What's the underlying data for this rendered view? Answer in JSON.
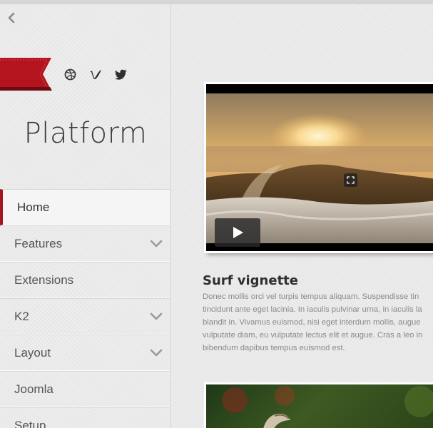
{
  "sidebar": {
    "back_icon": "chevron-left-icon",
    "social": [
      {
        "name": "dribbble-icon"
      },
      {
        "name": "vimeo-icon"
      },
      {
        "name": "twitter-icon"
      }
    ],
    "brand": "Platform",
    "accent_color": "#a31720",
    "nav": [
      {
        "label": "Home",
        "active": true,
        "has_submenu": false
      },
      {
        "label": "Features",
        "active": false,
        "has_submenu": true
      },
      {
        "label": "Extensions",
        "active": false,
        "has_submenu": false
      },
      {
        "label": "K2",
        "active": false,
        "has_submenu": true
      },
      {
        "label": "Layout",
        "active": false,
        "has_submenu": true
      },
      {
        "label": "Joomla",
        "active": false,
        "has_submenu": false
      },
      {
        "label": "Setup",
        "active": false,
        "has_submenu": false
      }
    ]
  },
  "main": {
    "posts": [
      {
        "title": "Surf vignette",
        "body": "Donec mollis orci vel turpis tempus aliquam. Suspendisse tin\ntincidunt ante eget lacinia. In iaculis pulvinar urna, in iaculis la\nblandit in. Vivamus euismod, nisi eget interdum mollis, augue\nvulputate diam, eu vulputate lectus elit et augue. Cras a leo in\nbibendum dapibus tempus euismod est.",
        "media": {
          "type": "video",
          "play_icon": "play-icon",
          "expand_icon": "expand-icon"
        }
      }
    ]
  }
}
